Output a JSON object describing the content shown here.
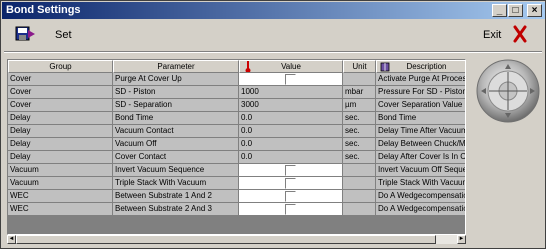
{
  "window": {
    "title": "Bond Settings",
    "controls": {
      "minimize": "_",
      "maximize": "□",
      "close": "×"
    }
  },
  "toolbar": {
    "set_label": "Set",
    "exit_label": "Exit",
    "save_icon": "save-disk-icon",
    "exit_icon": "red-x-icon"
  },
  "table": {
    "headers": [
      "Group",
      "Parameter",
      "Value",
      "Unit",
      "Description"
    ],
    "header_icons": {
      "value": "thermometer-icon",
      "description": "book-icon"
    },
    "rows": [
      {
        "group": "Cover",
        "parameter": "Purge At Cover Up",
        "value": "",
        "unit": "",
        "description": "Activate Purge At Process End",
        "checkbox": true
      },
      {
        "group": "Cover",
        "parameter": "SD - Piston",
        "value": "1000",
        "unit": "mbar",
        "description": "Pressure For SD - Piston",
        "checkbox": false
      },
      {
        "group": "Cover",
        "parameter": "SD - Separation",
        "value": "3000",
        "unit": "µm",
        "description": "Cover Separation Value Before",
        "checkbox": false
      },
      {
        "group": "Delay",
        "parameter": "Bond Time",
        "value": "0.0",
        "unit": "sec.",
        "description": "Bond Time",
        "checkbox": false
      },
      {
        "group": "Delay",
        "parameter": "Vacuum Contact",
        "value": "0.0",
        "unit": "sec.",
        "description": "Delay Time After Vacuum Contact",
        "checkbox": false
      },
      {
        "group": "Delay",
        "parameter": "Vacuum Off",
        "value": "0.0",
        "unit": "sec.",
        "description": "Delay Between Chuck/Mask",
        "checkbox": false
      },
      {
        "group": "Delay",
        "parameter": "Cover Contact",
        "value": "0.0",
        "unit": "sec.",
        "description": "Delay After Cover Is In Contact",
        "checkbox": false
      },
      {
        "group": "Vacuum",
        "parameter": "Invert Vacuum Sequence",
        "value": "",
        "unit": "",
        "description": "Invert Vacuum Off Sequence",
        "checkbox": true
      },
      {
        "group": "Vacuum",
        "parameter": "Triple Stack With Vacuum",
        "value": "",
        "unit": "",
        "description": "Triple Stack With Vacuum",
        "checkbox": true
      },
      {
        "group": "WEC",
        "parameter": "Between Substrate 1 And 2",
        "value": "",
        "unit": "",
        "description": "Do A Wedgecompensation",
        "checkbox": true
      },
      {
        "group": "WEC",
        "parameter": "Between Substrate 2 And 3",
        "value": "",
        "unit": "",
        "description": "Do A Wedgecompensation",
        "checkbox": true
      }
    ]
  },
  "scrollbar": {
    "left_arrow": "◄",
    "right_arrow": "►"
  },
  "side_panel": {
    "icon": "joystick-control-icon"
  }
}
